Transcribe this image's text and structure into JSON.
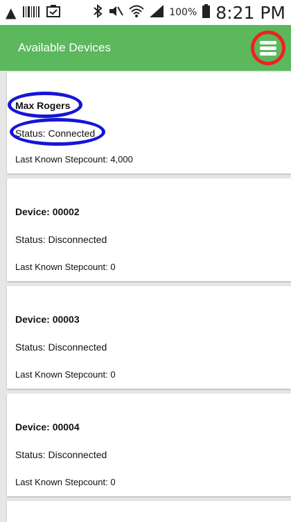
{
  "status_bar": {
    "time": "8:21 PM",
    "battery": "100%",
    "icons": [
      "warning-icon",
      "barcode-icon",
      "clipboard-check-icon",
      "bluetooth-icon",
      "mute-icon",
      "wifi-icon",
      "signal-icon",
      "battery-icon"
    ]
  },
  "app_bar": {
    "title": "Available Devices",
    "menu_icon": "hamburger-menu-icon",
    "background": "#5cb85c"
  },
  "devices": [
    {
      "title": "Max Rogers",
      "status": "Status: Connected",
      "steps": "Last Known Stepcount: 4,000"
    },
    {
      "title": "Device: 00002",
      "status": "Status: Disconnected",
      "steps": "Last Known Stepcount: 0"
    },
    {
      "title": "Device: 00003",
      "status": "Status: Disconnected",
      "steps": "Last Known Stepcount: 0"
    },
    {
      "title": "Device: 00004",
      "status": "Status: Disconnected",
      "steps": "Last Known Stepcount: 0"
    }
  ],
  "annotation_colors": {
    "menu_highlight": "#ee2222",
    "item_highlight": "#1515d6"
  }
}
